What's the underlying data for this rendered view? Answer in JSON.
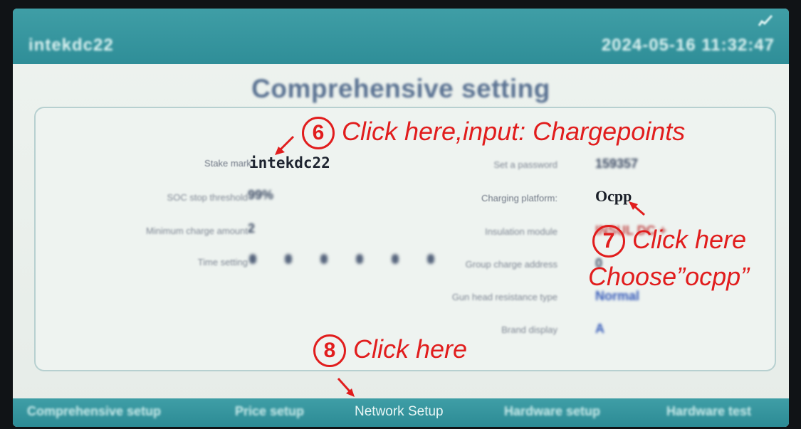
{
  "header": {
    "device_id": "intekdc22",
    "datetime": "2024-05-16 11:32:47",
    "signal_icon": "signal-icon"
  },
  "page_title": "Comprehensive setting",
  "left_fields": [
    {
      "label": "Stake mark :",
      "value": "intekdc22"
    },
    {
      "label": "SOC stop threshold",
      "value": "99%"
    },
    {
      "label": "Minimum charge amount",
      "value": "2"
    },
    {
      "label": "Time setting",
      "value": ""
    }
  ],
  "right_fields": [
    {
      "label": "Set a password",
      "value": "159357"
    },
    {
      "label": "Charging platform:",
      "value": "Ocpp"
    },
    {
      "label": "Insulation module",
      "value": "INSUL DC +"
    },
    {
      "label": "Group charge address",
      "value": "0"
    },
    {
      "label": "Gun head resistance type",
      "value": "Normal"
    },
    {
      "label": "Brand display",
      "value": "A"
    }
  ],
  "annotations": {
    "step6_num": "6",
    "step6_text": "Click here,input: Chargepoints",
    "step7_num": "7",
    "step7_text": "Click here",
    "step7_text2": "Choose”ocpp”",
    "step8_num": "8",
    "step8_text": "Click here",
    "color": "#e11d1d"
  },
  "tabs": [
    {
      "label": "Comprehensive setup"
    },
    {
      "label": "Price setup"
    },
    {
      "label": "Network Setup"
    },
    {
      "label": "Hardware setup"
    },
    {
      "label": "Hardware test"
    }
  ],
  "colors": {
    "bar": "#3a98a1",
    "background": "#eef3ef",
    "title": "#5a7292",
    "annotation": "#e11d1d"
  }
}
